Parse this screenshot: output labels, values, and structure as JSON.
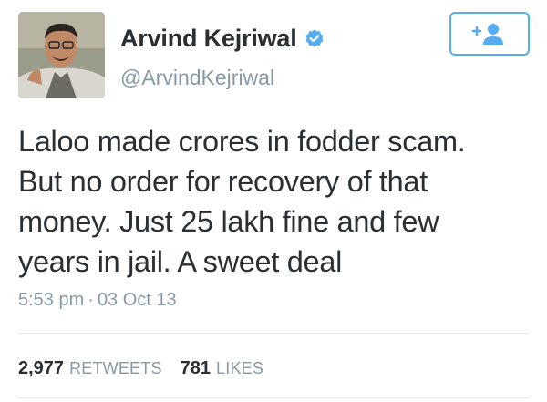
{
  "user": {
    "display_name": "Arvind Kejriwal",
    "handle": "@ArvindKejriwal",
    "verified_icon": "verified-badge-icon",
    "avatar_icon": "profile-photo"
  },
  "follow_button": {
    "icon": "follow-plus-person-icon",
    "color": "#55acee"
  },
  "tweet": {
    "lines": [
      "Laloo made crores in fodder scam.",
      "But no order for recovery of that",
      "money. Just 25 lakh fine and few",
      "years in jail. A sweet deal"
    ]
  },
  "meta": {
    "time": "5:53 pm",
    "separator": "·",
    "date": "03 Oct 13"
  },
  "stats": {
    "retweets_count": "2,977",
    "retweets_label": "RETWEETS",
    "likes_count": "781",
    "likes_label": "LIKES"
  },
  "colors": {
    "accent": "#55acee",
    "text": "#292f33",
    "muted": "#8899a6",
    "divider": "#e1e8ed"
  }
}
